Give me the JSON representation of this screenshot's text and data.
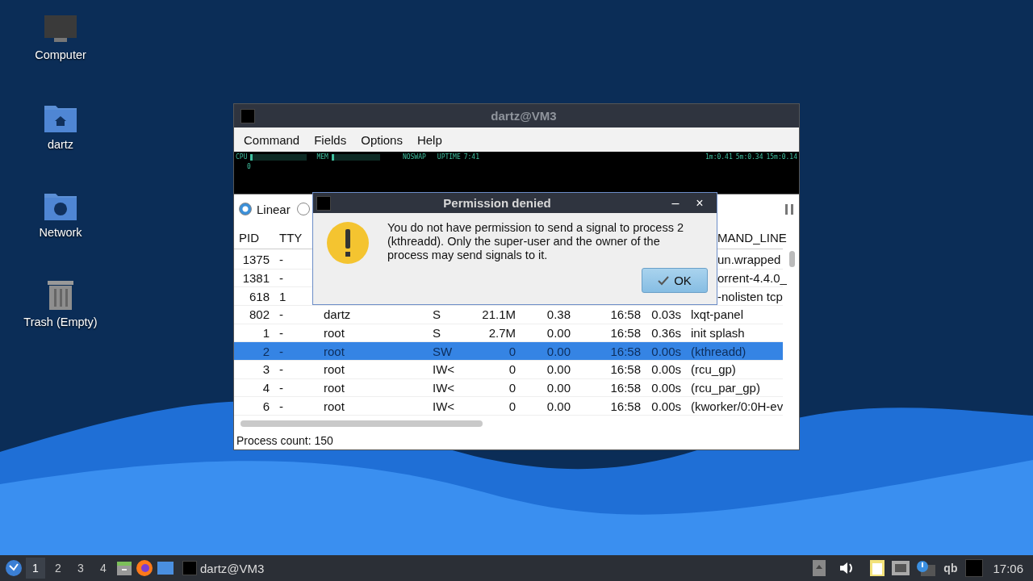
{
  "desktop_icons": [
    {
      "kind": "computer",
      "label": "Computer"
    },
    {
      "kind": "home",
      "label": "dartz"
    },
    {
      "kind": "network",
      "label": "Network"
    },
    {
      "kind": "trash",
      "label": "Trash (Empty)"
    }
  ],
  "window": {
    "title": "dartz@VM3",
    "menu": [
      "Command",
      "Fields",
      "Options",
      "Help"
    ],
    "monitor": {
      "cpu": "CPU",
      "mem": "MEM",
      "swap": "NOSWAP",
      "uptime_label": "UPTIME",
      "uptime": "7:41",
      "cpu_scale": "0",
      "loads": [
        "1m:0.41",
        "5m:0.34",
        "15m:0.14"
      ]
    },
    "view_modes": [
      {
        "label": "Linear",
        "selected": true
      },
      {
        "selected": false
      }
    ],
    "table": {
      "columns": {
        "pid": "PID",
        "tty": "TTY",
        "command": "MAND_LINE"
      },
      "rows": [
        {
          "pid": "1375",
          "tty": "-",
          "cmd": "un.wrapped",
          "selected": false
        },
        {
          "pid": "1381",
          "tty": "-",
          "cmd": "orrent-4.4.0_",
          "selected": false
        },
        {
          "pid": "618",
          "tty": "1",
          "cmd": "-nolisten tcp",
          "selected": false
        },
        {
          "pid": "802",
          "tty": "-",
          "user": "dartz",
          "stat": "S",
          "mem": "21.1M",
          "cpu": "0.38",
          "start": "16:58",
          "time": "0.03s",
          "cmd": "lxqt-panel",
          "selected": false
        },
        {
          "pid": "1",
          "tty": "-",
          "user": "root",
          "stat": "S",
          "mem": "2.7M",
          "cpu": "0.00",
          "start": "16:58",
          "time": "0.36s",
          "cmd": "init splash",
          "selected": false
        },
        {
          "pid": "2",
          "tty": "-",
          "user": "root",
          "stat": "SW",
          "mem": "0",
          "cpu": "0.00",
          "start": "16:58",
          "time": "0.00s",
          "cmd": "(kthreadd)",
          "selected": true
        },
        {
          "pid": "3",
          "tty": "-",
          "user": "root",
          "stat": "IW<",
          "mem": "0",
          "cpu": "0.00",
          "start": "16:58",
          "time": "0.00s",
          "cmd": "(rcu_gp)",
          "selected": false
        },
        {
          "pid": "4",
          "tty": "-",
          "user": "root",
          "stat": "IW<",
          "mem": "0",
          "cpu": "0.00",
          "start": "16:58",
          "time": "0.00s",
          "cmd": "(rcu_par_gp)",
          "selected": false
        },
        {
          "pid": "6",
          "tty": "-",
          "user": "root",
          "stat": "IW<",
          "mem": "0",
          "cpu": "0.00",
          "start": "16:58",
          "time": "0.00s",
          "cmd": "(kworker/0:0H-ev",
          "selected": false
        }
      ]
    },
    "status": "Process count: 150"
  },
  "dialog": {
    "title": "Permission denied",
    "minimize": "–",
    "close": "×",
    "message": "You do not have permission to send a signal to process 2 (kthreadd). Only the super-user and the owner of the process may send signals to it.",
    "ok": "OK"
  },
  "taskbar": {
    "workspaces": [
      {
        "label": "1",
        "selected": true
      },
      {
        "label": "2",
        "selected": false
      },
      {
        "label": "3",
        "selected": false
      },
      {
        "label": "4",
        "selected": false
      }
    ],
    "task": "dartz@VM3",
    "tray_text": "qb",
    "clock": "17:06"
  }
}
